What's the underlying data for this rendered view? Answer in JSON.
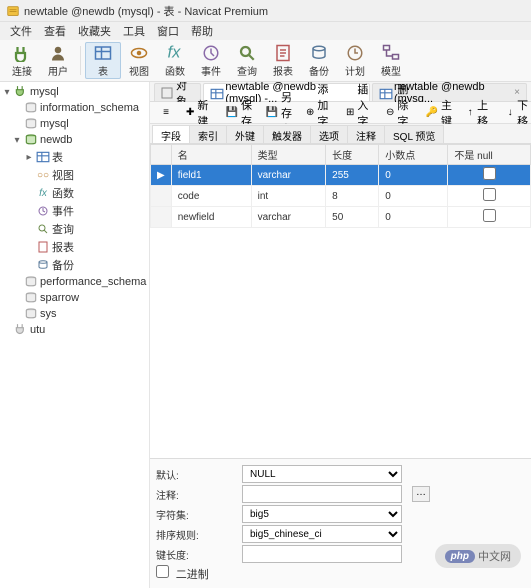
{
  "window": {
    "title": "newtable @newdb (mysql) - 表 - Navicat Premium"
  },
  "menu": [
    "文件",
    "查看",
    "收藏夹",
    "工具",
    "窗口",
    "帮助"
  ],
  "toolbar": [
    {
      "id": "connect",
      "label": "连接",
      "color": "#5a8f3d"
    },
    {
      "id": "user",
      "label": "用户",
      "color": "#7a6a4a"
    },
    {
      "id": "sep"
    },
    {
      "id": "table",
      "label": "表",
      "color": "#4a7ab8",
      "active": true
    },
    {
      "id": "view",
      "label": "视图",
      "color": "#b87a2a"
    },
    {
      "id": "function",
      "label": "函数",
      "color": "#4a9a9a"
    },
    {
      "id": "event",
      "label": "事件",
      "color": "#8a6aa8"
    },
    {
      "id": "query",
      "label": "查询",
      "color": "#6a8a4a"
    },
    {
      "id": "report",
      "label": "报表",
      "color": "#b85a5a"
    },
    {
      "id": "backup",
      "label": "备份",
      "color": "#5a7a9a"
    },
    {
      "id": "schedule",
      "label": "计划",
      "color": "#9a7a5a"
    },
    {
      "id": "model",
      "label": "模型",
      "color": "#7a5a8a"
    }
  ],
  "tree": [
    {
      "l": "mysql",
      "icon": "db-conn",
      "depth": 0,
      "tw": "▾"
    },
    {
      "l": "information_schema",
      "icon": "db",
      "depth": 1,
      "tw": ""
    },
    {
      "l": "mysql",
      "icon": "db",
      "depth": 1,
      "tw": ""
    },
    {
      "l": "newdb",
      "icon": "db-open",
      "depth": 1,
      "tw": "▾"
    },
    {
      "l": "表",
      "icon": "table",
      "depth": 2,
      "tw": "▸"
    },
    {
      "l": "视图",
      "icon": "view",
      "depth": 2,
      "tw": ""
    },
    {
      "l": "函数",
      "icon": "fx",
      "depth": 2,
      "tw": ""
    },
    {
      "l": "事件",
      "icon": "event",
      "depth": 2,
      "tw": ""
    },
    {
      "l": "查询",
      "icon": "query",
      "depth": 2,
      "tw": ""
    },
    {
      "l": "报表",
      "icon": "report",
      "depth": 2,
      "tw": ""
    },
    {
      "l": "备份",
      "icon": "backup",
      "depth": 2,
      "tw": ""
    },
    {
      "l": "performance_schema",
      "icon": "db",
      "depth": 1,
      "tw": ""
    },
    {
      "l": "sparrow",
      "icon": "db",
      "depth": 1,
      "tw": ""
    },
    {
      "l": "sys",
      "icon": "db",
      "depth": 1,
      "tw": ""
    },
    {
      "l": "utu",
      "icon": "db-conn-off",
      "depth": 0,
      "tw": ""
    }
  ],
  "tabs": [
    {
      "label": "对象",
      "icon": "obj",
      "active": false
    },
    {
      "label": "newtable @newdb (mysql) -...",
      "icon": "table",
      "active": true
    },
    {
      "label": "newtable @newdb (mysq...",
      "icon": "table",
      "active": false
    }
  ],
  "objbar": [
    {
      "icon": "menu",
      "label": ""
    },
    {
      "icon": "new",
      "label": "新建"
    },
    {
      "icon": "save",
      "label": "保存"
    },
    {
      "icon": "saveas",
      "label": "另存为"
    },
    {
      "icon": "addfield",
      "label": "添加字段"
    },
    {
      "icon": "insertfield",
      "label": "插入字段"
    },
    {
      "icon": "delfield",
      "label": "删除字段"
    },
    {
      "icon": "pk",
      "label": "主键"
    },
    {
      "icon": "up",
      "label": "上移"
    },
    {
      "icon": "down",
      "label": "下移"
    }
  ],
  "subtabs": [
    "字段",
    "索引",
    "外键",
    "触发器",
    "选项",
    "注释",
    "SQL 预览"
  ],
  "subtab_active": 0,
  "grid": {
    "headers": [
      "名",
      "类型",
      "长度",
      "小数点",
      "不是 null"
    ],
    "rows": [
      {
        "name": "field1",
        "type": "varchar",
        "len": "255",
        "dec": "0",
        "nn": false,
        "selected": true
      },
      {
        "name": "code",
        "type": "int",
        "len": "8",
        "dec": "0",
        "nn": false,
        "selected": false
      },
      {
        "name": "newfield",
        "type": "varchar",
        "len": "50",
        "dec": "0",
        "nn": false,
        "selected": false
      }
    ]
  },
  "props": {
    "default_label": "默认:",
    "default_value": "NULL",
    "comment_label": "注释:",
    "comment_value": "",
    "charset_label": "字符集:",
    "charset_value": "big5",
    "collate_label": "排序规则:",
    "collate_value": "big5_chinese_ci",
    "keylen_label": "键长度:",
    "keylen_value": "",
    "binary_label": "二进制"
  },
  "watermark": {
    "php": "php",
    "txt": "中文网"
  }
}
